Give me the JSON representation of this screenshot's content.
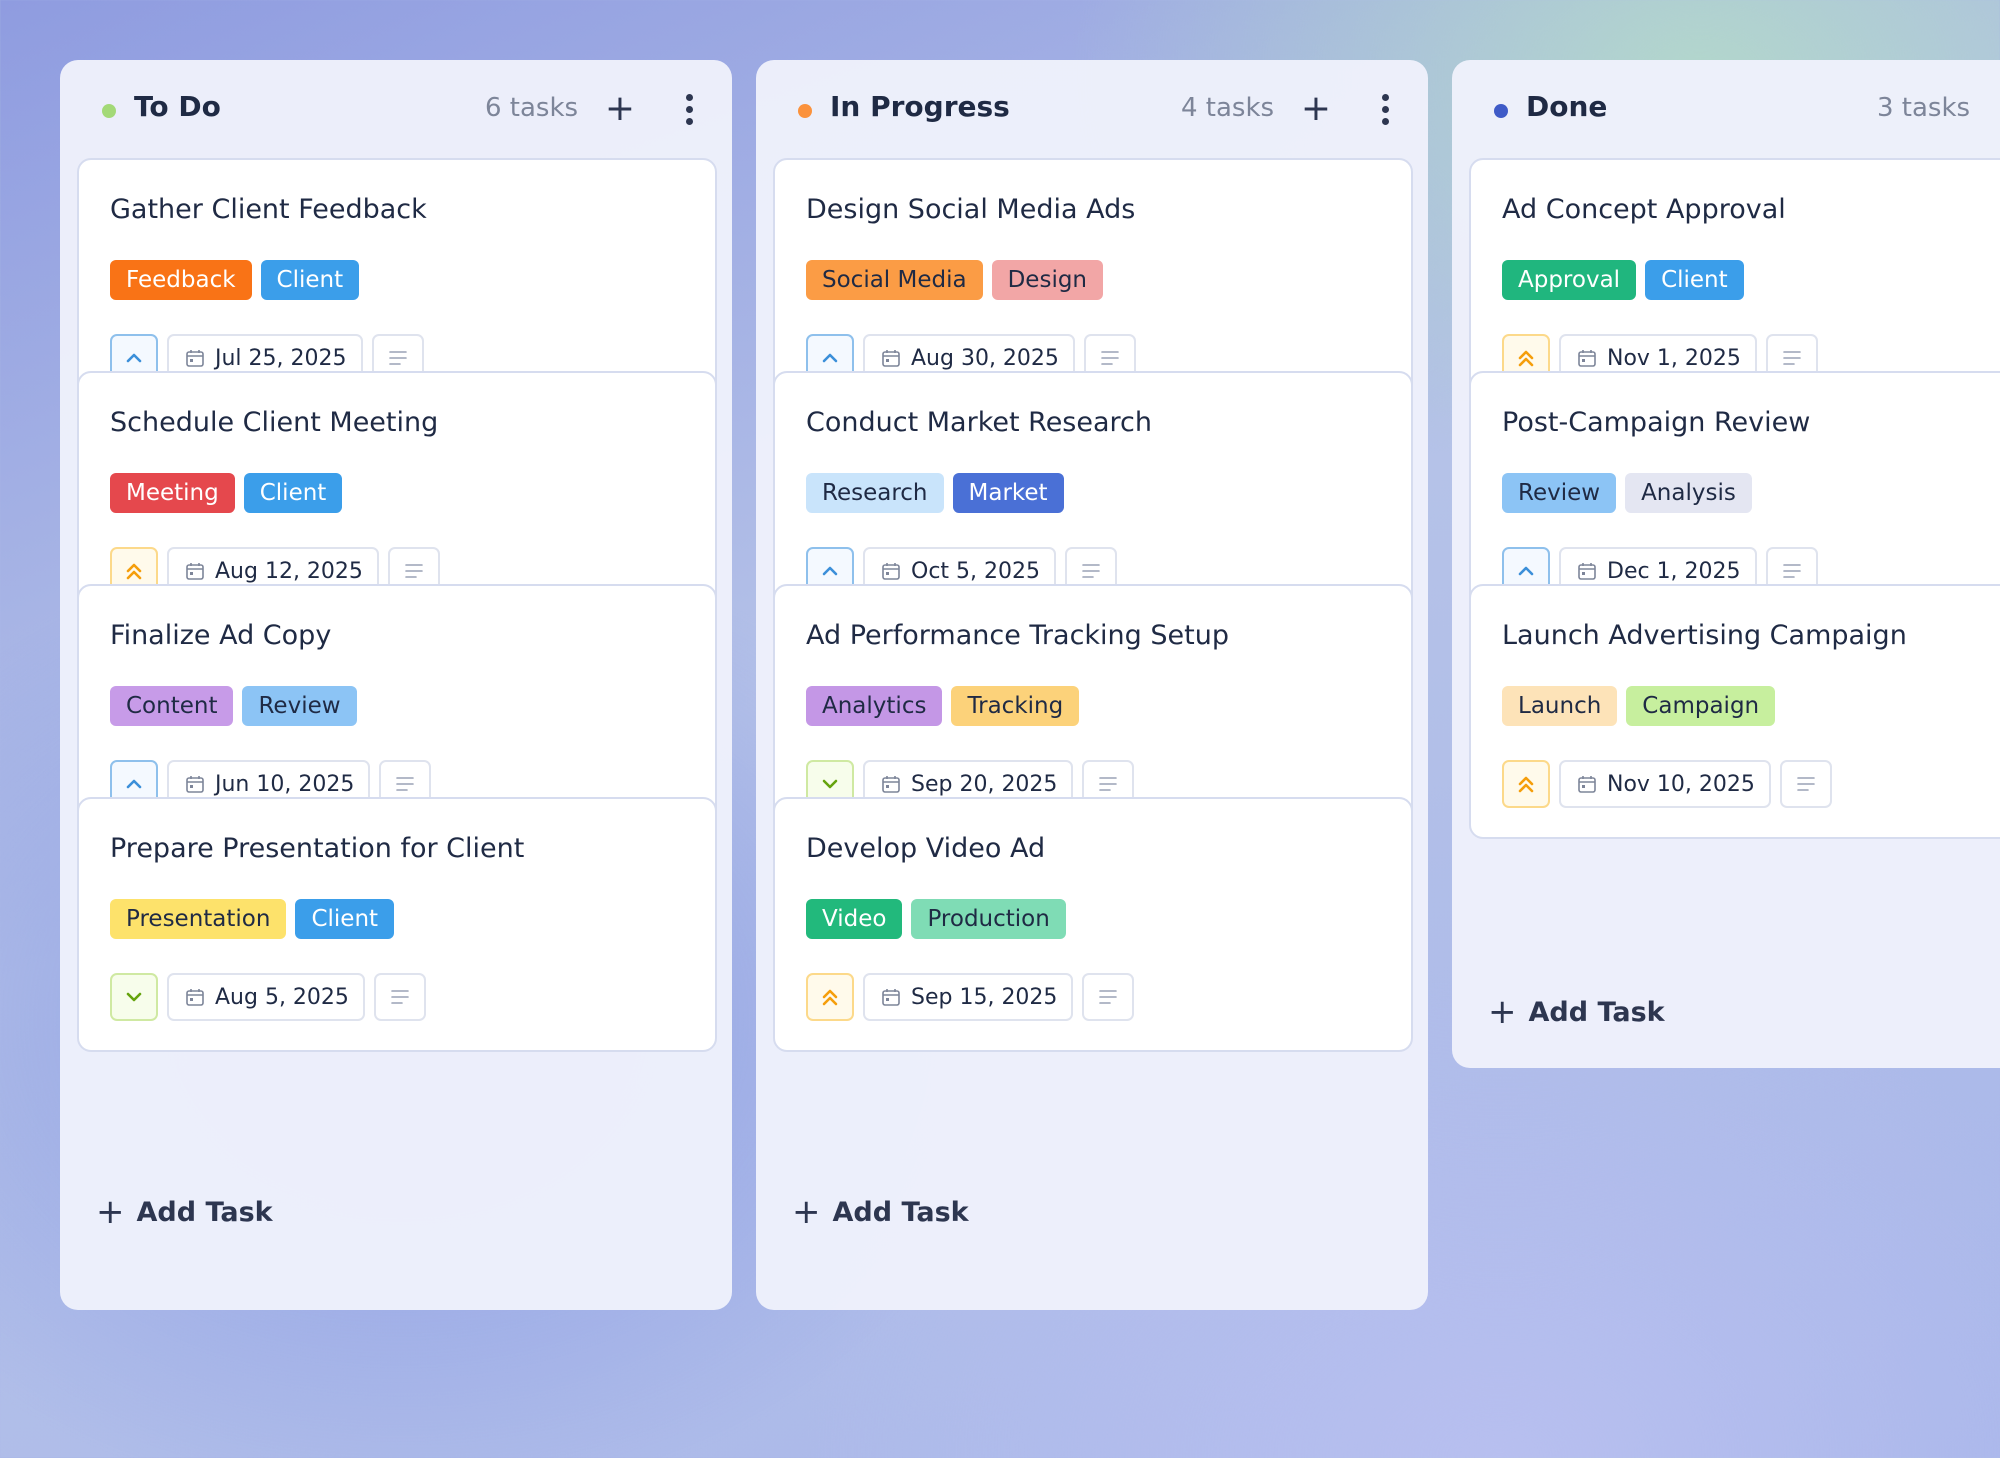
{
  "colors": {
    "todo_dot": "#a3d977",
    "progress_dot": "#fb923c",
    "done_dot": "#3f5bc7",
    "priority_medium": "#3b8fd9",
    "priority_high": "#f59e0b",
    "priority_low": "#65a30d"
  },
  "columns": [
    {
      "title": "To Do",
      "count": "6 tasks",
      "add_label": "Add Task",
      "add_icon": "+",
      "cards": [
        {
          "title": "Gather Client Feedback",
          "tags": [
            "Feedback",
            "Client"
          ],
          "priority": "medium",
          "date": "Jul 25, 2025"
        },
        {
          "title": "Schedule Client Meeting",
          "tags": [
            "Meeting",
            "Client"
          ],
          "priority": "high",
          "date": "Aug 12, 2025"
        },
        {
          "title": "Finalize Ad Copy",
          "tags": [
            "Content",
            "Review"
          ],
          "priority": "medium",
          "date": "Jun 10, 2025"
        },
        {
          "title": "Prepare Presentation for Client",
          "tags": [
            "Presentation",
            "Client"
          ],
          "priority": "low",
          "date": "Aug 5, 2025"
        }
      ]
    },
    {
      "title": "In Progress",
      "count": "4 tasks",
      "add_label": "Add Task",
      "add_icon": "+",
      "cards": [
        {
          "title": "Design Social Media Ads",
          "tags": [
            "Social Media",
            "Design"
          ],
          "priority": "medium",
          "date": "Aug 30, 2025"
        },
        {
          "title": "Conduct Market Research",
          "tags": [
            "Research",
            "Market"
          ],
          "priority": "medium",
          "date": "Oct 5, 2025"
        },
        {
          "title": "Ad Performance Tracking Setup",
          "tags": [
            "Analytics",
            "Tracking"
          ],
          "priority": "low",
          "date": "Sep 20, 2025"
        },
        {
          "title": "Develop Video Ad",
          "tags": [
            "Video",
            "Production"
          ],
          "priority": "high",
          "date": "Sep 15, 2025"
        }
      ]
    },
    {
      "title": "Done",
      "count": "3 tasks",
      "add_label": "Add Task",
      "add_icon": "+",
      "cards": [
        {
          "title": "Ad Concept Approval",
          "tags": [
            "Approval",
            "Client"
          ],
          "priority": "high",
          "date": "Nov 1, 2025"
        },
        {
          "title": "Post-Campaign Review",
          "tags": [
            "Review",
            "Analysis"
          ],
          "priority": "medium",
          "date": "Dec 1, 2025"
        },
        {
          "title": "Launch Advertising Campaign",
          "tags": [
            "Launch",
            "Campaign"
          ],
          "priority": "high",
          "date": "Nov 10, 2025"
        }
      ]
    }
  ],
  "head_icons": {
    "plus": "+"
  },
  "tag_colors": {
    "Feedback": {
      "bg": "#f97316",
      "fg": "#ffffff"
    },
    "Client": {
      "bg": "#3b9eea",
      "fg": "#ffffff"
    },
    "Meeting": {
      "bg": "#e5484d",
      "fg": "#ffffff"
    },
    "Content": {
      "bg": "#c79be8",
      "fg": "#1f2a44"
    },
    "Review": {
      "bg": "#8cc4f5",
      "fg": "#1f2a44"
    },
    "Presentation": {
      "bg": "#fde26b",
      "fg": "#1f2a44"
    },
    "Social Media": {
      "bg": "#fb9c45",
      "fg": "#1f2a44"
    },
    "Design": {
      "bg": "#f2a6a6",
      "fg": "#1f2a44"
    },
    "Research": {
      "bg": "#c9e4fb",
      "fg": "#1f2a44"
    },
    "Market": {
      "bg": "#4a70d6",
      "fg": "#ffffff"
    },
    "Analytics": {
      "bg": "#c497e6",
      "fg": "#1f2a44"
    },
    "Tracking": {
      "bg": "#fcd27a",
      "fg": "#1f2a44"
    },
    "Video": {
      "bg": "#22b97c",
      "fg": "#ffffff"
    },
    "Production": {
      "bg": "#7fdcb5",
      "fg": "#1f2a44"
    },
    "Approval": {
      "bg": "#20b67e",
      "fg": "#ffffff"
    },
    "Analysis": {
      "bg": "#e4e6f2",
      "fg": "#1f2a44"
    },
    "Launch": {
      "bg": "#fde3b8",
      "fg": "#1f2a44"
    },
    "Campaign": {
      "bg": "#c7ef9e",
      "fg": "#1f2a44"
    }
  },
  "icons": {
    "priority_medium": "chevron-up-icon",
    "priority_high": "double-chevron-up-icon",
    "priority_low": "chevron-down-icon",
    "date": "calendar-icon",
    "notes": "notes-icon",
    "menu": "more-vertical-icon",
    "add": "plus-icon"
  }
}
